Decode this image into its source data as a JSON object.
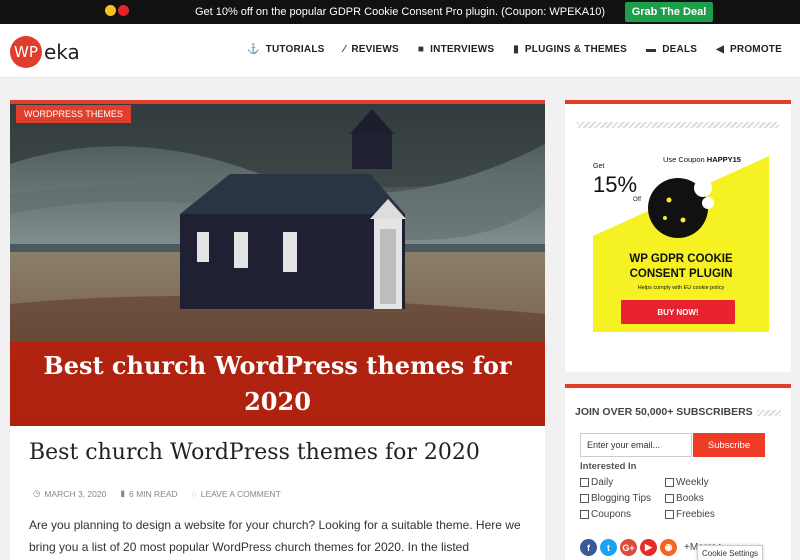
{
  "promo": {
    "text": "Get 10% off on the popular GDPR Cookie Consent Pro plugin. (Coupon: WPEKA10)",
    "button": "Grab The Deal"
  },
  "logo": {
    "badge": "WP",
    "text": "eka"
  },
  "nav": [
    {
      "label": "TUTORIALS",
      "icon": "anchor-icon",
      "glyph": "⚓"
    },
    {
      "label": "REVIEWS",
      "icon": "wand-icon",
      "glyph": "⁄"
    },
    {
      "label": "INTERVIEWS",
      "icon": "chat-icon",
      "glyph": "■"
    },
    {
      "label": "PLUGINS & THEMES",
      "icon": "book-icon",
      "glyph": "▮"
    },
    {
      "label": "DEALS",
      "icon": "ticket-icon",
      "glyph": "▬"
    },
    {
      "label": "PROMOTE",
      "icon": "megaphone-icon",
      "glyph": "◀"
    }
  ],
  "article": {
    "category": "WORDPRESS THEMES",
    "hero_title": "Best church WordPress themes for 2020",
    "title": "Best church WordPress themes for 2020",
    "date": "MARCH 3, 2020",
    "read_time": "6 MIN READ",
    "comment": "LEAVE A COMMENT",
    "excerpt": "Are you planning to design a website for your church? Looking for a suitable theme. Here we bring you a list of 20 most popular WordPress church themes for 2020. In the listed"
  },
  "ad": {
    "get": "Get",
    "percent": "15%",
    "off": "Off",
    "coupon_prefix": "Use Coupon",
    "coupon_code": "HAPPY15",
    "line1": "WP GDPR COOKIE",
    "line2": "CONSENT PLUGIN",
    "tagline": "Helps comply with EU cookie policy",
    "cta": "BUY NOW!"
  },
  "subscribe": {
    "title": "JOIN OVER 50,000+ SUBSCRIBERS",
    "email_placeholder": "Enter your email...",
    "button": "Subscribe",
    "interested": "Interested In",
    "options": [
      "Daily",
      "Weekly",
      "Blogging Tips",
      "Books",
      "Coupons",
      "Freebies"
    ],
    "more": "+More>>"
  },
  "social": [
    {
      "name": "facebook-icon",
      "glyph": "f",
      "color": "#3b5998"
    },
    {
      "name": "twitter-icon",
      "glyph": "t",
      "color": "#1da1f2"
    },
    {
      "name": "google-plus-icon",
      "glyph": "G+",
      "color": "#dd4b39"
    },
    {
      "name": "youtube-icon",
      "glyph": "▶",
      "color": "#e52d27"
    },
    {
      "name": "rss-icon",
      "glyph": "◉",
      "color": "#f26522"
    }
  ],
  "cookie_settings": "Cookie Settings",
  "colors": {
    "accent": "#e03e2d",
    "promo_button": "#1e9e4a",
    "ad_yellow": "#f5f122"
  }
}
